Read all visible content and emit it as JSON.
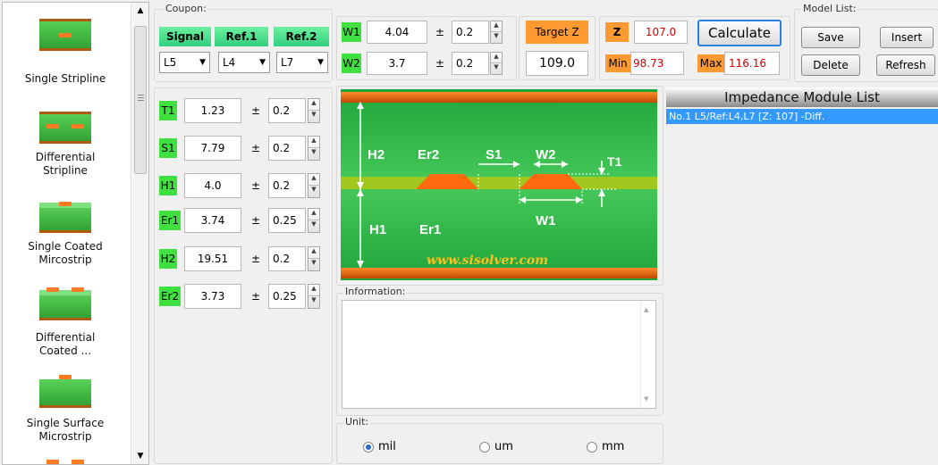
{
  "sidebar": {
    "items": [
      {
        "label": "Single Stripline"
      },
      {
        "label": "Differential Stripline"
      },
      {
        "label": "Single Coated Mircostrip"
      },
      {
        "label": "Differential Coated ..."
      },
      {
        "label": "Single Surface Microstrip"
      }
    ]
  },
  "coupon": {
    "legend": "Coupon:",
    "signal_label": "Signal",
    "ref1_label": "Ref.1",
    "ref2_label": "Ref.2",
    "signal_value": "L5",
    "ref1_value": "L4",
    "ref2_value": "L7"
  },
  "width_params": {
    "w1": {
      "label": "W1",
      "value": "4.04",
      "tol": "0.2"
    },
    "w2": {
      "label": "W2",
      "value": "3.7",
      "tol": "0.2"
    },
    "pm": "±"
  },
  "target": {
    "label": "Target Z",
    "value": "109.0"
  },
  "result": {
    "z_label": "Z",
    "z_value": "107.0",
    "min_label": "Min",
    "min_value": "98.73",
    "max_label": "Max",
    "max_value": "116.16",
    "calculate_label": "Calculate"
  },
  "model_list": {
    "legend": "Model List:",
    "save": "Save",
    "insert": "Insert",
    "delete": "Delete",
    "refresh": "Refresh"
  },
  "params": [
    {
      "label": "T1",
      "value": "1.23",
      "tol": "0.2"
    },
    {
      "label": "S1",
      "value": "7.79",
      "tol": "0.2"
    },
    {
      "label": "H1",
      "value": "4.0",
      "tol": "0.2"
    },
    {
      "label": "Er1",
      "value": "3.74",
      "tol": "0.25"
    },
    {
      "label": "H2",
      "value": "19.51",
      "tol": "0.2"
    },
    {
      "label": "Er2",
      "value": "3.73",
      "tol": "0.25"
    }
  ],
  "diagram": {
    "h2": "H2",
    "er2": "Er2",
    "s1": "S1",
    "w2": "W2",
    "t1": "T1",
    "h1": "H1",
    "er1": "Er1",
    "w1": "W1",
    "watermark": "www.sisolver.com"
  },
  "information": {
    "legend": "Information:",
    "text": ""
  },
  "unit": {
    "legend": "Unit:",
    "options": [
      "mil",
      "um",
      "mm"
    ],
    "selected": "mil"
  },
  "impedance_list": {
    "header": "Impedance  Module  List",
    "rows": [
      "No.1  L5/Ref:L4,L7 [Z: 107] -Diff."
    ]
  }
}
